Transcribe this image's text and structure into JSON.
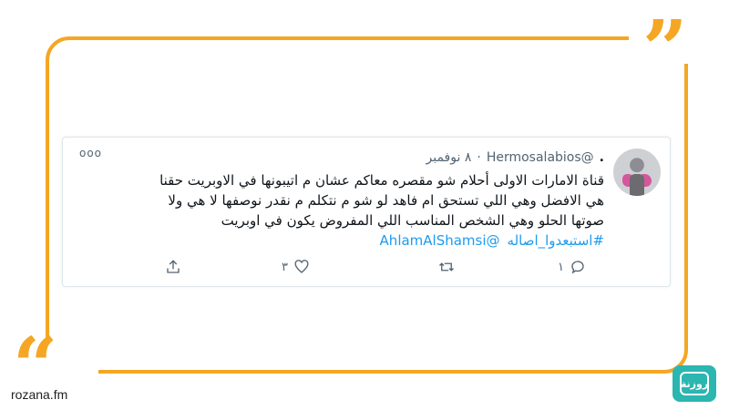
{
  "tweet": {
    "display_name": ".",
    "handle": "@Hermosalabios",
    "separator": "·",
    "date": "٨ نوفمبر",
    "more_label": "ooo",
    "lines": [
      "قناة الامارات الاولى أحلام شو مقصره معاكم عشان م اتيبونها في الاوبريت حقنا",
      "هي الافضل وهي اللي تستحق ام فاهد لو شو م نتكلم م نقدر نوصفها لا هي ولا",
      "صوتها الحلو وهي الشخص المناسب اللي المفروض يكون في اوبريت"
    ],
    "hashtag": "#استبعدوا_اصاله",
    "mention": "@AhlamAlShamsi",
    "likes": "٣",
    "replies": "١"
  },
  "brand": {
    "site": "rozana.fm",
    "logo_text": "روزنة"
  },
  "colors": {
    "accent": "#f5a623",
    "link": "#1d9bf0",
    "logo": "#2bb6b0"
  }
}
